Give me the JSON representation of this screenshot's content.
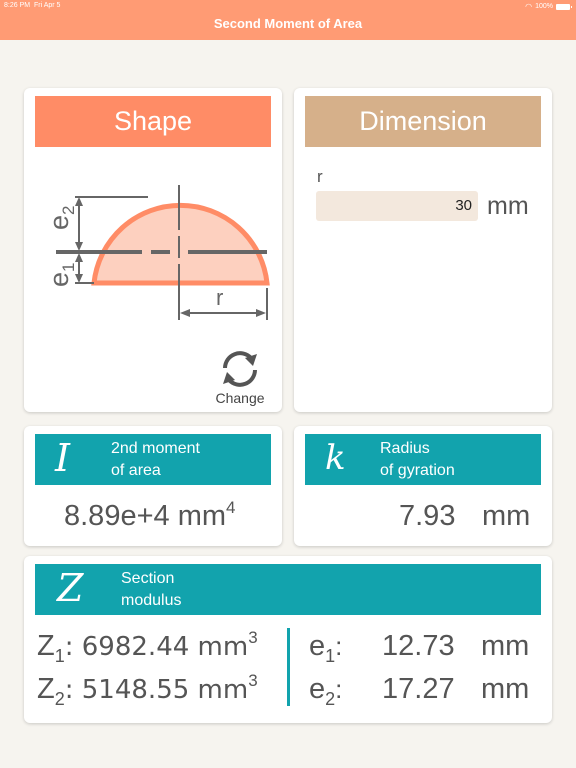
{
  "status": {
    "time": "8:26 PM",
    "date": "Fri Apr 5",
    "battery": "100%"
  },
  "nav": {
    "title": "Second Moment of Area"
  },
  "shape_card": {
    "button_label": "Shape",
    "change_label": "Change",
    "diagram_labels": {
      "e1": "e",
      "e1_sub": "1",
      "e2": "e",
      "e2_sub": "2",
      "r": "r"
    }
  },
  "dimension_card": {
    "button_label": "Dimension",
    "field_label": "r",
    "field_value": "30",
    "unit": "mm"
  },
  "moment_card": {
    "symbol": "I",
    "label_line1": "2nd moment",
    "label_line2": "of area",
    "value": "8.89e+4 mm",
    "unit_exp": "4"
  },
  "gyration_card": {
    "symbol": "k",
    "label_line1": "Radius",
    "label_line2": "of gyration",
    "value": "7.93",
    "unit": "mm"
  },
  "section_card": {
    "symbol": "Z",
    "label_line1": "Section",
    "label_line2": "modulus",
    "z1": {
      "letter": "Z",
      "sub": "1",
      "value": ": 6982.44 mm",
      "exp": "3"
    },
    "z2": {
      "letter": "Z",
      "sub": "2",
      "value": ": 5148.55 mm",
      "exp": "3"
    },
    "e1": {
      "letter": "e",
      "sub": "1",
      "colon": ":",
      "value": "12.73",
      "unit": "mm"
    },
    "e2": {
      "letter": "e",
      "sub": "2",
      "colon": ":",
      "value": "17.27",
      "unit": "mm"
    }
  },
  "colors": {
    "accent": "#ff9b74",
    "shape_button": "#ff8c66",
    "dimension_button": "#d6b08a",
    "teal": "#12a3ad",
    "input_bg": "#f3e8dd"
  }
}
